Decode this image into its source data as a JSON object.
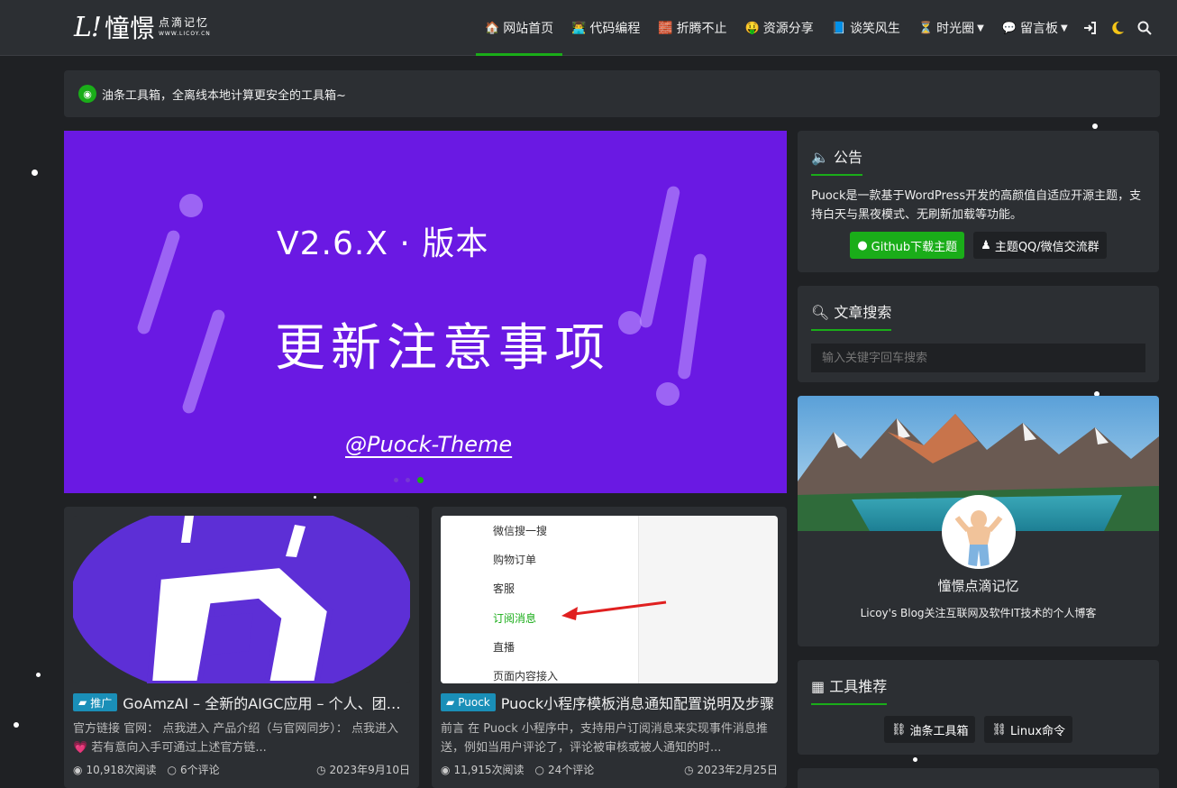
{
  "header": {
    "logo_mark": "L!",
    "logo_name": "憧憬",
    "logo_cn": "点滴记忆",
    "logo_en": "WWW.LICOY.CN",
    "nav": [
      {
        "emoji": "🏠",
        "label": "网站首页",
        "active": true,
        "dropdown": false
      },
      {
        "emoji": "👨‍💻",
        "label": "代码编程",
        "active": false,
        "dropdown": false
      },
      {
        "emoji": "🧱",
        "label": "折腾不止",
        "active": false,
        "dropdown": false
      },
      {
        "emoji": "🤑",
        "label": "资源分享",
        "active": false,
        "dropdown": false
      },
      {
        "emoji": "📘",
        "label": "谈笑风生",
        "active": false,
        "dropdown": false
      },
      {
        "emoji": "⏳",
        "label": "时光圈",
        "active": false,
        "dropdown": true
      },
      {
        "emoji": "💬",
        "label": "留言板",
        "active": false,
        "dropdown": true
      }
    ],
    "icons": [
      "login-icon",
      "moon-icon",
      "search-icon"
    ]
  },
  "notice": {
    "text": "油条工具箱，全离线本地计算更安全的工具箱~"
  },
  "banner": {
    "version": "V2.6.X · 版本",
    "title": "更新注意事项",
    "handle": "@Puock-Theme"
  },
  "posts": [
    {
      "tag": "推广",
      "title": "GoAmzAI – 全新的AIGC应用 – 个人、团队、企业AI解决方案",
      "excerpt": "官方链接 官网： 点我进入 产品介绍（与官网同步）： 点我进入 💗 若有意向入手可通过上述官方链...",
      "views": "10,918次阅读",
      "comments": "6个评论",
      "date": "2023年9月10日"
    },
    {
      "tag": "Puock",
      "title": "Puock小程序模板消息通知配置说明及步骤",
      "excerpt": "前言 在 Puock 小程序中，支持用户订阅消息来实现事件消息推送，例如当用户评论了，评论被审核或被人通知的时...",
      "views": "11,915次阅读",
      "comments": "24个评论",
      "date": "2023年2月25日",
      "thumb_menu": [
        "微信搜一搜",
        "购物订单",
        "客服",
        "订阅消息",
        "直播",
        "页面内容接入"
      ]
    }
  ],
  "sidebar": {
    "announcement": {
      "title": "公告",
      "text": "Puock是一款基于WordPress开发的高颜值自适应开源主题，支持白天与黑夜模式、无刷新加载等功能。",
      "btn_github": "Github下载主题",
      "btn_qq": "主题QQ/微信交流群"
    },
    "search": {
      "title": "文章搜索",
      "placeholder": "输入关键字回车搜索"
    },
    "profile": {
      "name": "憧憬点滴记忆",
      "desc": "Licoy's Blog关注互联网及软件IT技术的个人博客"
    },
    "tools": {
      "title": "工具推荐",
      "items": [
        "油条工具箱",
        "Linux命令"
      ]
    }
  },
  "colors": {
    "accent": "#1aad19",
    "banner_bg": "#6a19e3",
    "page_bg": "#1f2124",
    "panel_bg": "#2c2f33",
    "tag_bg": "#1a8fb8"
  }
}
